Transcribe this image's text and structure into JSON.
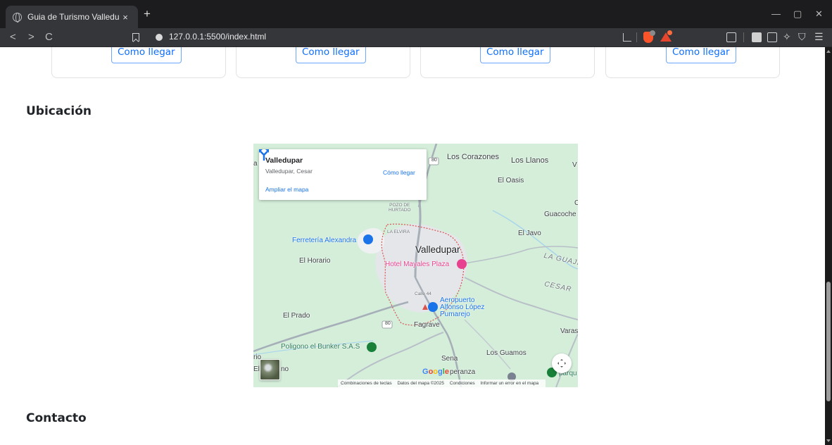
{
  "browser": {
    "tab_title": "Guia de Turismo Valledupar",
    "tab_close": "×",
    "new_tab": "+",
    "url": "127.0.0.1:5500/index.html",
    "nav_back": "<",
    "nav_forward": ">",
    "nav_reload": "C",
    "win_minimize": "—",
    "win_restore": "▢",
    "win_close": "✕"
  },
  "cards": {
    "button_label": "Como llegar"
  },
  "sections": {
    "ubicacion": "Ubicación",
    "contacto": "Contacto"
  },
  "map": {
    "place_name": "Valledupar",
    "place_region": "Valledupar, Cesar",
    "directions_label": "Cómo llegar",
    "enlarge_link": "Ampliar el mapa",
    "labels": {
      "los_corazones": "Los Corazones",
      "los_llanos": "Los Llanos",
      "el_oasis": "El Oasis",
      "guacoche": "Guacoche",
      "el_javo": "El Javo",
      "valledupar": "Valledupar",
      "ferreteria": "Ferretería Alexandra",
      "el_horario": "El Horario",
      "hotel": "Hotel Mayales Plaza",
      "la_guajira": "LA GUAJIR",
      "cesar": "CESAR",
      "calle44": "Calle 44",
      "aeropuerto": "Aeropuerto\nAlfonso López\nPumarejo",
      "el_prado": "El Prado",
      "fagrave": "Fagrave",
      "vara": "Varas",
      "poligono": "Poligono el Bunker S.A.S",
      "sena": "Sena",
      "los_guamos": "Los Guamos",
      "esperanza": "peranza",
      "el_no": "El",
      "no": "no",
      "rio": "rio",
      "parq": "parqu",
      "la_elvira": "LA ELVIRA",
      "pozo": "POZO DE\nHURTADO",
      "route80": "80",
      "a": "a",
      "v": "V",
      "c": "C"
    },
    "google": "Google",
    "attribution": [
      "Combinaciones de teclas",
      "Datos del mapa ©2025",
      "Condiciones",
      "Informar un error en el mapa"
    ]
  },
  "colors": {
    "accent": "#0d6efd",
    "map_link": "#1a73e8",
    "map_land": "#d4eeda"
  }
}
